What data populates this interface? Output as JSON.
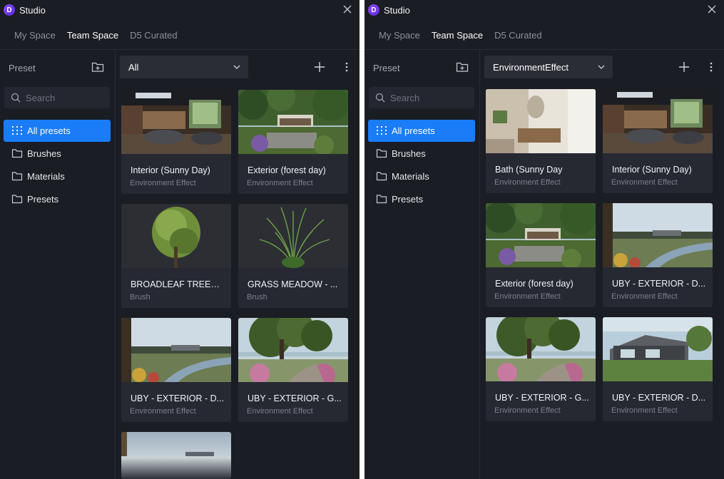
{
  "colors": {
    "panel_bg": "#1b1d24",
    "card_bg": "#262932",
    "accent": "#1a7cf7",
    "logo": "#7b3ff5"
  },
  "app": {
    "logo_text": "D",
    "title": "Studio"
  },
  "tabs": [
    "My Space",
    "Team Space",
    "D5 Curated"
  ],
  "active_tab": "Team Space",
  "sidebar": {
    "header": "Preset",
    "search_placeholder": "Search",
    "items": [
      {
        "label": "All presets",
        "icon": "grid-icon",
        "selected": true
      },
      {
        "label": "Brushes",
        "icon": "folder-icon"
      },
      {
        "label": "Materials",
        "icon": "folder-icon"
      },
      {
        "label": "Presets",
        "icon": "folder-icon"
      }
    ]
  },
  "panels": [
    {
      "filter": "All",
      "cards": [
        {
          "title": "Interior (Sunny Day)",
          "type": "Environment Effect",
          "thumb": "interior"
        },
        {
          "title": "Exterior (forest day)",
          "type": "Environment Effect",
          "thumb": "forest"
        },
        {
          "title": "BROADLEAF TREES ...",
          "type": "Brush",
          "thumb": "tree"
        },
        {
          "title": "GRASS MEADOW - ...",
          "type": "Brush",
          "thumb": "grass"
        },
        {
          "title": "UBY - EXTERIOR - D...",
          "type": "Environment Effect",
          "thumb": "river"
        },
        {
          "title": "UBY - EXTERIOR - G...",
          "type": "Environment Effect",
          "thumb": "oak"
        },
        {
          "title": "",
          "type": "",
          "thumb": "sky"
        }
      ]
    },
    {
      "filter": "EnvironmentEffect",
      "cards": [
        {
          "title": "Bath (Sunny Day",
          "type": "Environment Effect",
          "thumb": "bath"
        },
        {
          "title": "Interior (Sunny Day)",
          "type": "Environment Effect",
          "thumb": "interior"
        },
        {
          "title": "Exterior (forest day)",
          "type": "Environment Effect",
          "thumb": "forest"
        },
        {
          "title": "UBY - EXTERIOR - D...",
          "type": "Environment Effect",
          "thumb": "river"
        },
        {
          "title": "UBY - EXTERIOR - G...",
          "type": "Environment Effect",
          "thumb": "oak"
        },
        {
          "title": "UBY - EXTERIOR - D...",
          "type": "Environment Effect",
          "thumb": "house"
        }
      ]
    }
  ]
}
